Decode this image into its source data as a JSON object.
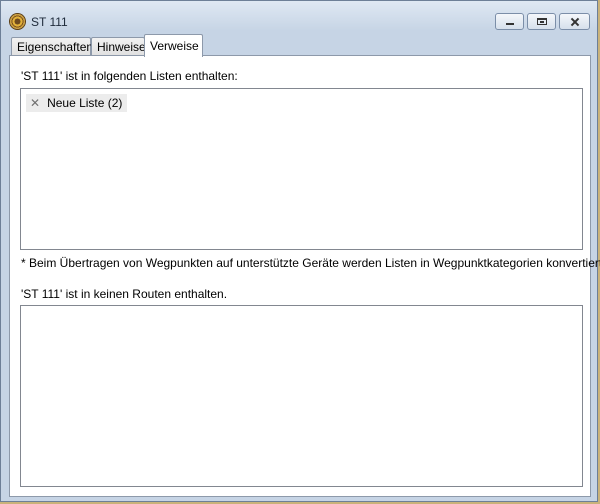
{
  "window": {
    "title": "ST 111"
  },
  "tabs": [
    {
      "label": "Eigenschaften"
    },
    {
      "label": "Hinweise"
    },
    {
      "label": "Verweise"
    }
  ],
  "references": {
    "lists_label": "'ST 111' ist in folgenden Listen enthalten:",
    "lists": [
      {
        "label": "Neue Liste (2)"
      }
    ],
    "note": "* Beim Übertragen von Wegpunkten auf unterstützte Geräte werden Listen in Wegpunktkategorien konvertiert.",
    "routes_label": "'ST 111' ist in keinen Routen enthalten.",
    "routes": []
  },
  "icons": {
    "remove_chip": "close-icon",
    "app": "geocache-icon"
  }
}
